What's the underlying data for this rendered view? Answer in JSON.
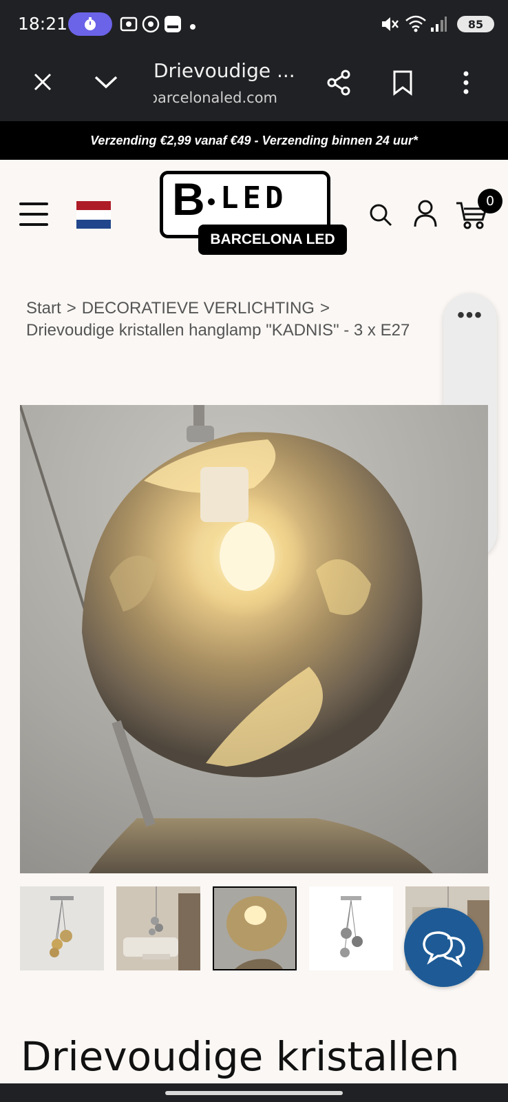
{
  "status_bar": {
    "time": "18:21",
    "battery": "85",
    "icons": [
      "timer-icon",
      "screen-record-icon",
      "chrome-icon",
      "gallery-icon",
      "mute-icon",
      "wifi-icon",
      "signal-icon"
    ]
  },
  "browser_tab": {
    "title": "Drievoudige ...",
    "url": "barcelonaled.com",
    "icons": [
      "close-icon",
      "chevron-down-icon",
      "share-icon",
      "bookmark-icon",
      "more-vert-icon"
    ]
  },
  "promo": {
    "text": "Verzending €2,99 vanaf €49 - Verzending binnen 24 uur*"
  },
  "header": {
    "logo_letter": "B",
    "logo_led": "LED",
    "logo_tag": "BARCELONA LED",
    "cart_count": "0",
    "icons": [
      "menu-icon",
      "nl-flag-icon",
      "search-icon",
      "account-icon",
      "cart-icon"
    ]
  },
  "breadcrumb": {
    "items": [
      "Start",
      "DECORATIEVE VERLICHTING",
      "Drievoudige kristallen hanglamp \"KADNIS\" - 3 x E27"
    ],
    "separator": ">"
  },
  "side_toolbar": {
    "more": "•••",
    "icons": [
      "more-horiz-icon",
      "read-aloud-icon"
    ]
  },
  "product": {
    "title": "Drievoudige kristallen",
    "thumbnail_count": 5,
    "selected_thumbnail": 3
  },
  "colors": {
    "browser_bg": "#202124",
    "promo_bg": "#000000",
    "page_bg": "#faf7f4",
    "chat_bubble": "#1e5b96",
    "timer_pill": "#6b63e8"
  }
}
